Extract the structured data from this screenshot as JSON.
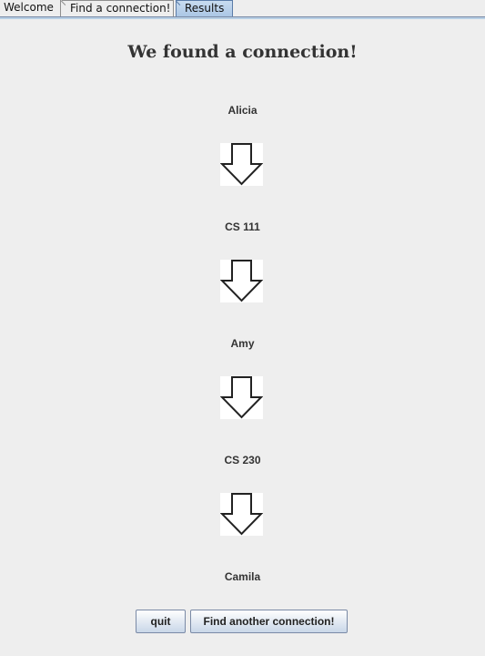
{
  "tabs": [
    {
      "label": "Welcome"
    },
    {
      "label": "Find a connection!"
    },
    {
      "label": "Results"
    }
  ],
  "active_tab": "Results",
  "title": "We found a connection!",
  "path": [
    {
      "label": "Alicia"
    },
    {
      "label": "CS 111"
    },
    {
      "label": "Amy"
    },
    {
      "label": "CS 230"
    },
    {
      "label": "Camila"
    }
  ],
  "arrow_icon": "down-arrow-icon",
  "buttons": {
    "quit": "quit",
    "again": "Find another connection!"
  }
}
